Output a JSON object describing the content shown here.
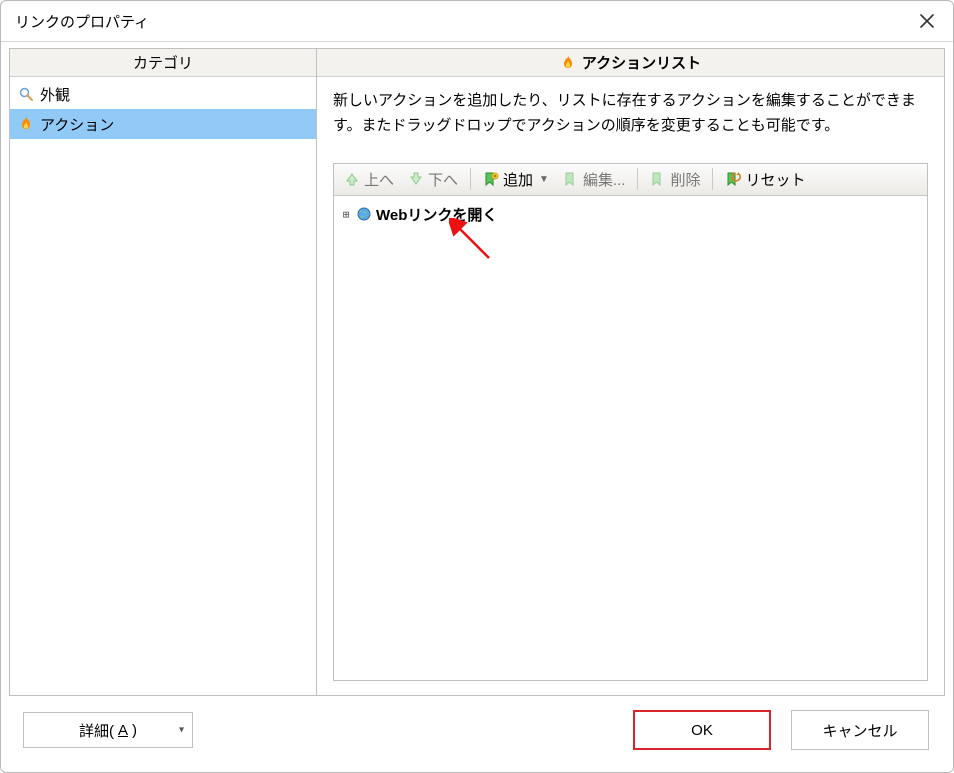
{
  "title": "リンクのプロパティ",
  "left": {
    "header": "カテゴリ",
    "items": [
      {
        "label": "外観",
        "icon": "magnifier"
      },
      {
        "label": "アクション",
        "icon": "flame",
        "selected": true
      }
    ]
  },
  "right": {
    "header": "アクションリスト",
    "description": "新しいアクションを追加したり、リストに存在するアクションを編集することができます。またドラッグドロップでアクションの順序を変更することも可能です。",
    "toolbar": {
      "up": "上へ",
      "down": "下へ",
      "add": "追加",
      "edit": "編集...",
      "delete": "削除",
      "reset": "リセット"
    },
    "items": [
      {
        "label": "Webリンクを開く",
        "icon": "globe"
      }
    ]
  },
  "footer": {
    "details_prefix": "詳細(",
    "details_key": "A",
    "details_suffix": ")",
    "ok": "OK",
    "cancel": "キャンセル"
  }
}
